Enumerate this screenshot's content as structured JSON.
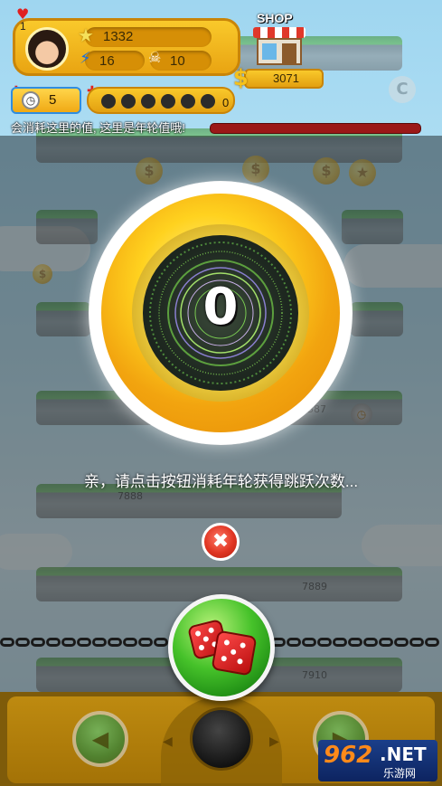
{
  "hud": {
    "lives": "1",
    "stars": "1332",
    "energy": "16",
    "skulls": "10",
    "shop_label": "SHOP",
    "coins": "3071",
    "timer_count": "5",
    "bomb_count": "0",
    "icons": {
      "heart": "heart-icon",
      "star": "star-icon",
      "lightning": "lightning-icon",
      "skull": "skull-icon",
      "dollar": "dollar-icon",
      "clock": "clock-icon",
      "plus": "plus-icon",
      "bomb": "bomb-icon"
    }
  },
  "hint": {
    "text": "会消耗这里的值, 这里是年轮值哦!"
  },
  "wheel": {
    "value": "0"
  },
  "message": {
    "text": "亲，请点击按钮消耗年轮获得跳跃次数..."
  },
  "background": {
    "platform_numbers": [
      "387",
      "7888",
      "7889",
      "7910"
    ]
  },
  "buttons": {
    "close_symbol": "✖",
    "dice_icon": "dice-icon",
    "left_arrow": "◀",
    "right_arrow": "▶"
  },
  "watermark": {
    "number": "962",
    "suffix": ".NET",
    "cn": "乐游网"
  },
  "colors": {
    "gold": "#f2a40f",
    "green_button": "#46c22a",
    "close_red": "#e03522",
    "hint_bar": "#9b1818"
  }
}
